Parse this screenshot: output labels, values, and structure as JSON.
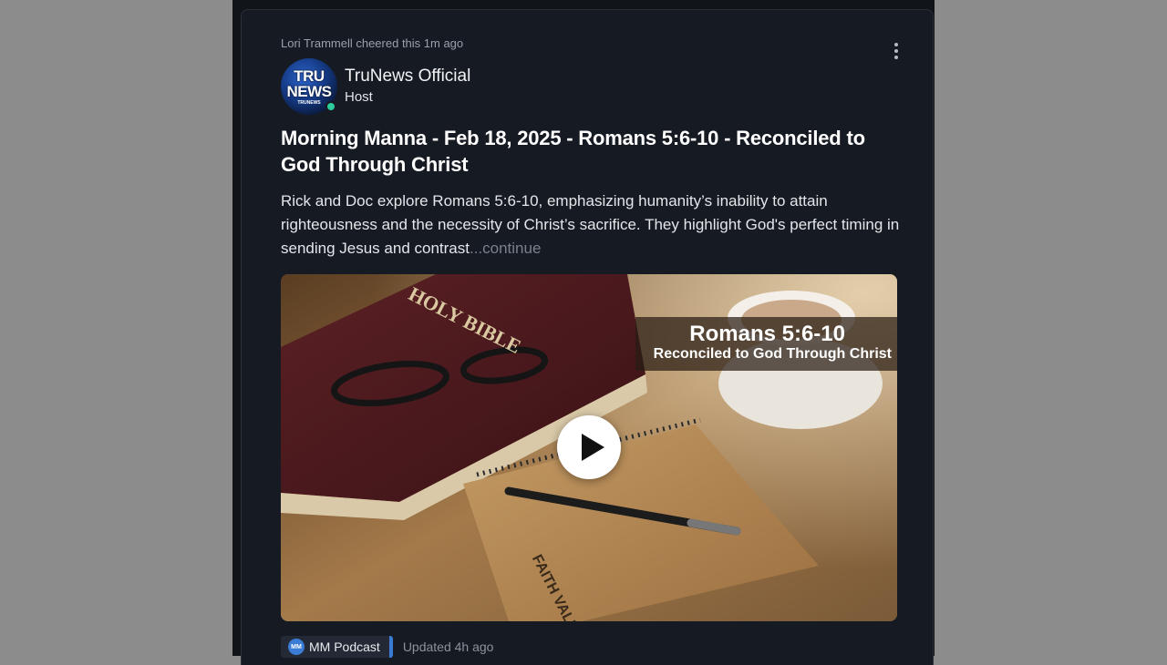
{
  "activity": {
    "text": "Lori Trammell cheered this 1m ago"
  },
  "author": {
    "avatar_text_top": "TRU",
    "avatar_text_bottom": "NEWS",
    "avatar_small": "TRUNEWS",
    "name": "TruNews Official",
    "role": "Host",
    "online": true
  },
  "post": {
    "title": "Morning Manna - Feb 18, 2025 - Romans 5:6-10 - Reconciled to God Through Christ",
    "excerpt": "Rick and Doc explore Romans 5:6-10, emphasizing humanity’s inability to attain righteousness and the necessity of Christ’s sacrifice. They highlight God's perfect timing in sending Jesus and contrast",
    "continue_label": "...continue"
  },
  "media": {
    "overlay_title": "Romans 5:6-10",
    "overlay_subtitle": "Reconciled to God Through Christ",
    "book_spine_text": "HOLY BIBLE",
    "notebook_text": "FAITH VALUES"
  },
  "footer": {
    "badge_icon_text": "MM",
    "badge_label": "MM Podcast",
    "updated": "Updated 4h ago"
  },
  "colors": {
    "page_bg": "#8c8c8c",
    "card_bg": "#161a22",
    "online": "#2ecc9a",
    "accent": "#3a7bd5"
  }
}
